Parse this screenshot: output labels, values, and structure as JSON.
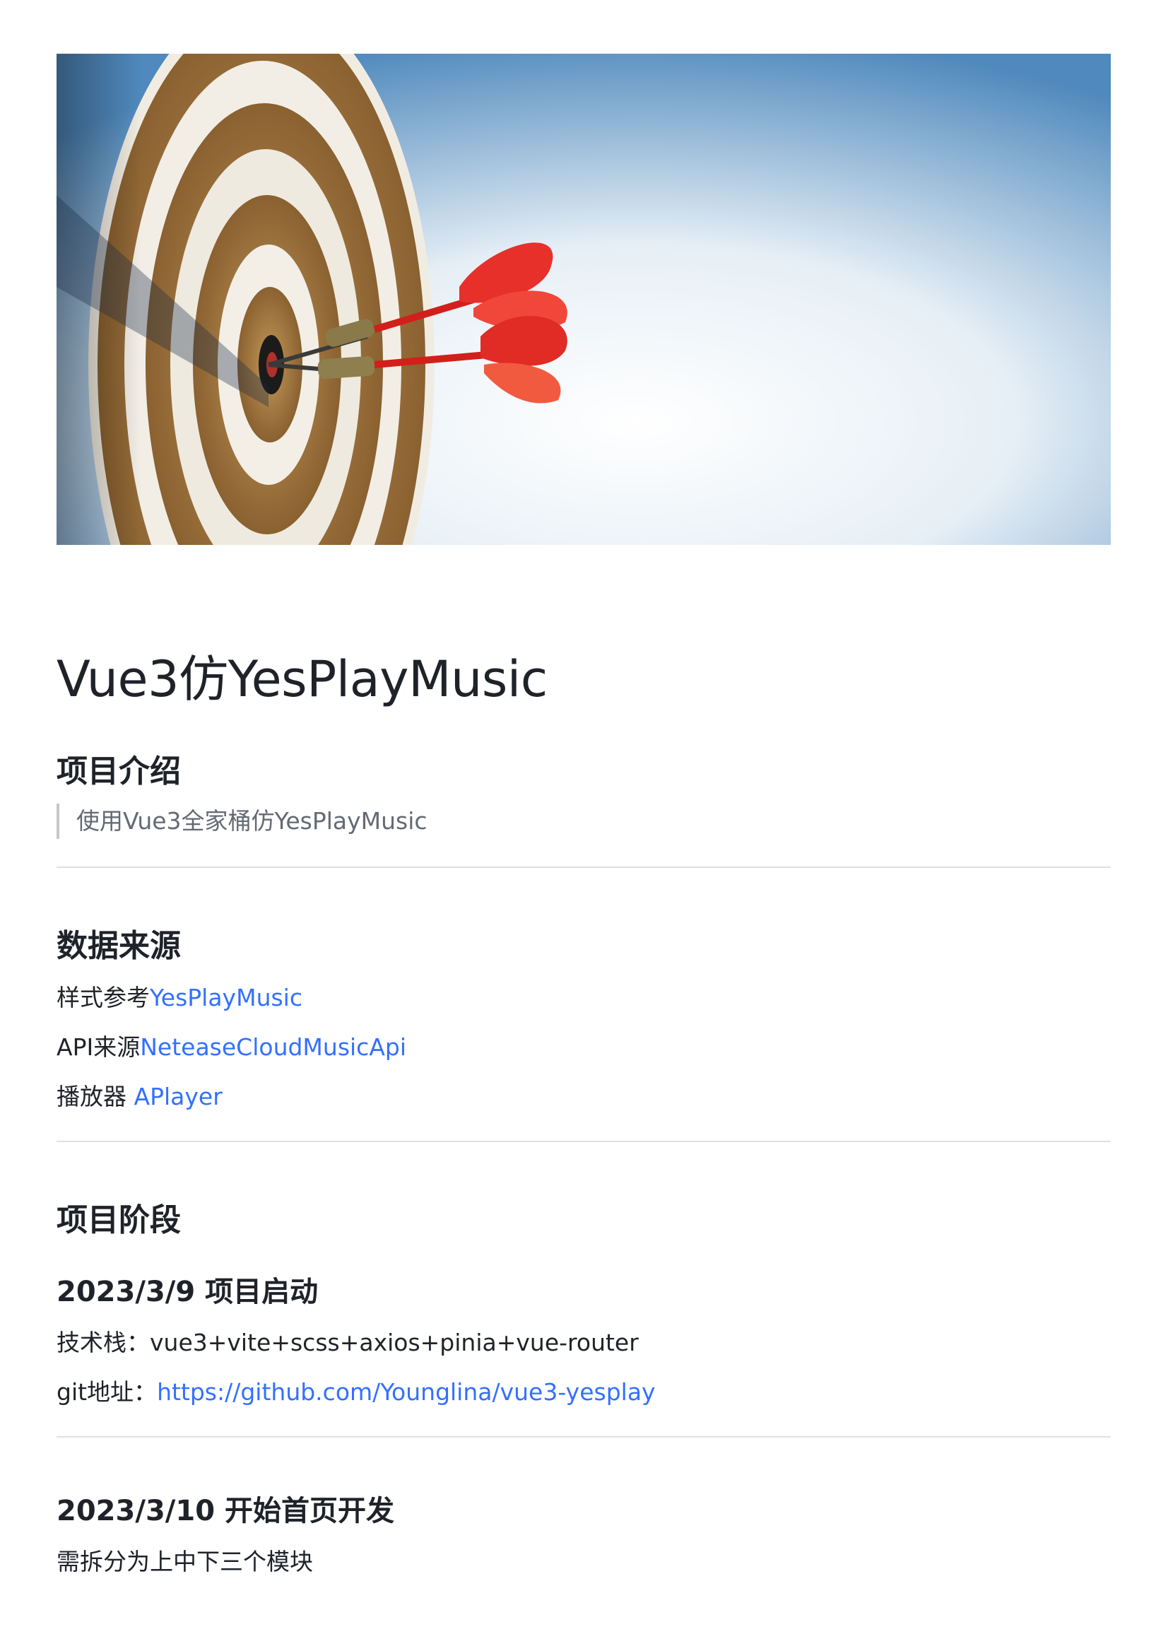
{
  "cover": {
    "image": "dartboard-with-red-darts-cover-image"
  },
  "title": "Vue3仿YesPlayMusic",
  "intro": {
    "heading": "项目介绍",
    "quote": "使用Vue3全家桶仿YesPlayMusic"
  },
  "sources": {
    "heading": "数据来源",
    "items": [
      {
        "label": "样式参考",
        "link": "YesPlayMusic"
      },
      {
        "label": "API来源",
        "link": "NeteaseCloudMusicApi"
      },
      {
        "label": "播放器 ",
        "link": "APlayer"
      }
    ]
  },
  "stages": {
    "heading": "项目阶段",
    "stage1": {
      "heading": "2023/3/9 项目启动",
      "tech_label": "技术栈：",
      "tech_value": "vue3+vite+scss+axios+pinia+vue-router",
      "git_label": "git地址：",
      "git_link": "https://github.com/Younglina/vue3-yesplay"
    },
    "stage2": {
      "heading": "2023/3/10 开始首页开发",
      "text": "需拆分为上中下三个模块"
    }
  },
  "colors": {
    "link": "#3370ff",
    "text": "#1f2329",
    "muted": "#646a73",
    "divider": "#dee0e3"
  }
}
